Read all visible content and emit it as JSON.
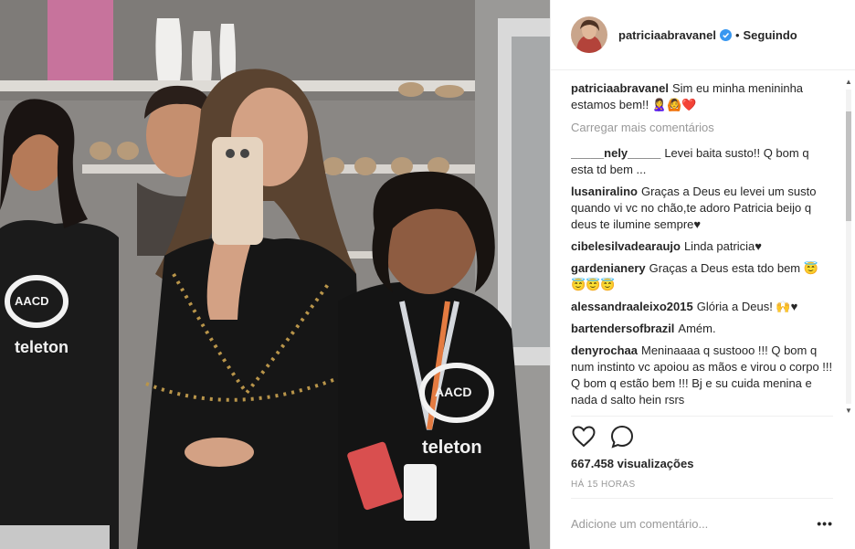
{
  "header": {
    "username": "patriciaabravanel",
    "separator": "•",
    "follow_status": "Seguindo"
  },
  "caption": {
    "username": "patriciaabravanel",
    "text": "Sim eu minha menininha estamos bem!! 🙎‍♀️🙆❤️"
  },
  "load_more": "Carregar mais comentários",
  "comments": [
    {
      "username": "_____nely_____",
      "text": "Levei baita susto!! Q bom q esta td bem ..."
    },
    {
      "username": "lusaniralino",
      "text": "Graças a Deus eu levei um susto quando vi vc no chão,te adoro Patricia beijo q deus te ilumine sempre♥"
    },
    {
      "username": "cibelesilvadearaujo",
      "text": "Linda patricia♥"
    },
    {
      "username": "gardenianery",
      "text": "Graças a Deus esta tdo bem 😇😇😇😇"
    },
    {
      "username": "alessandraaleixo2015",
      "text": "Glória a Deus! 🙌♥"
    },
    {
      "username": "bartendersofbrazil",
      "text": "Amém."
    },
    {
      "username": "denyrochaa",
      "text": "Meninaaaa q sustooo !!! Q bom q num instinto vc apoiou as mãos e virou o corpo !!! Q bom q estão bem !!! Bj e su cuida menina e nada d salto hein rsrs"
    }
  ],
  "stats": {
    "views": "667.458 visualizações",
    "time_ago": "HÁ 15 HORAS"
  },
  "add_comment": {
    "placeholder": "Adicione um comentário...",
    "more_label": "•••"
  },
  "photo": {
    "shirt_brand": "AACD",
    "shirt_text": "teleton"
  },
  "colors": {
    "verified": "#3897f0",
    "text": "#262626",
    "muted": "#999999",
    "border": "#efefef"
  }
}
